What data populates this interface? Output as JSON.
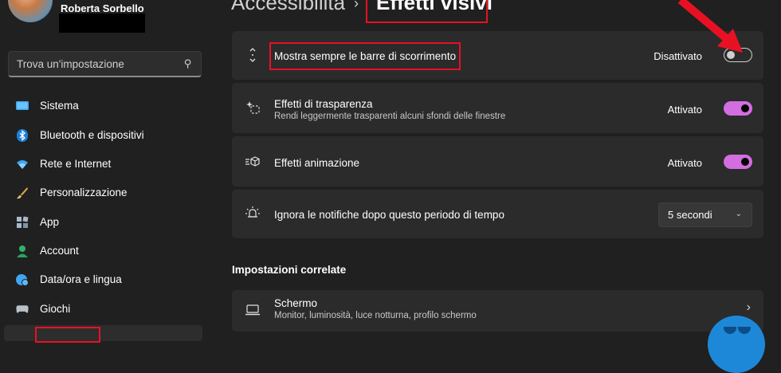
{
  "user": {
    "name": "Roberta Sorbello"
  },
  "search": {
    "placeholder": "Trova un'impostazione"
  },
  "sidebar": {
    "items": [
      {
        "label": "Sistema",
        "icon": "monitor-icon"
      },
      {
        "label": "Bluetooth e dispositivi",
        "icon": "bluetooth-icon"
      },
      {
        "label": "Rete e Internet",
        "icon": "wifi-icon"
      },
      {
        "label": "Personalizzazione",
        "icon": "brush-icon"
      },
      {
        "label": "App",
        "icon": "apps-icon"
      },
      {
        "label": "Account",
        "icon": "person-icon"
      },
      {
        "label": "Data/ora e lingua",
        "icon": "globe-clock-icon"
      },
      {
        "label": "Giochi",
        "icon": "gamepad-icon"
      }
    ]
  },
  "breadcrumb": {
    "parent": "Accessibilità",
    "separator": "›",
    "current": "Effetti visivi"
  },
  "settings": {
    "scrollbars": {
      "title": "Mostra sempre le barre di scorrimento",
      "state_label": "Disattivato",
      "enabled": false
    },
    "transparency": {
      "title": "Effetti di trasparenza",
      "subtitle": "Rendi leggermente trasparenti alcuni sfondi delle finestre",
      "state_label": "Attivato",
      "enabled": true
    },
    "animation": {
      "title": "Effetti animazione",
      "state_label": "Attivato",
      "enabled": true
    },
    "notifications": {
      "title": "Ignora le notifiche dopo questo periodo di tempo",
      "selected_value": "5 secondi"
    }
  },
  "related": {
    "heading": "Impostazioni correlate",
    "display": {
      "title": "Schermo",
      "subtitle": "Monitor, luminosità, luce notturna, profilo schermo"
    }
  },
  "colors": {
    "background": "#202020",
    "card": "#2b2b2b",
    "accent": "#d26ee0",
    "annotation_red": "#e81123"
  }
}
